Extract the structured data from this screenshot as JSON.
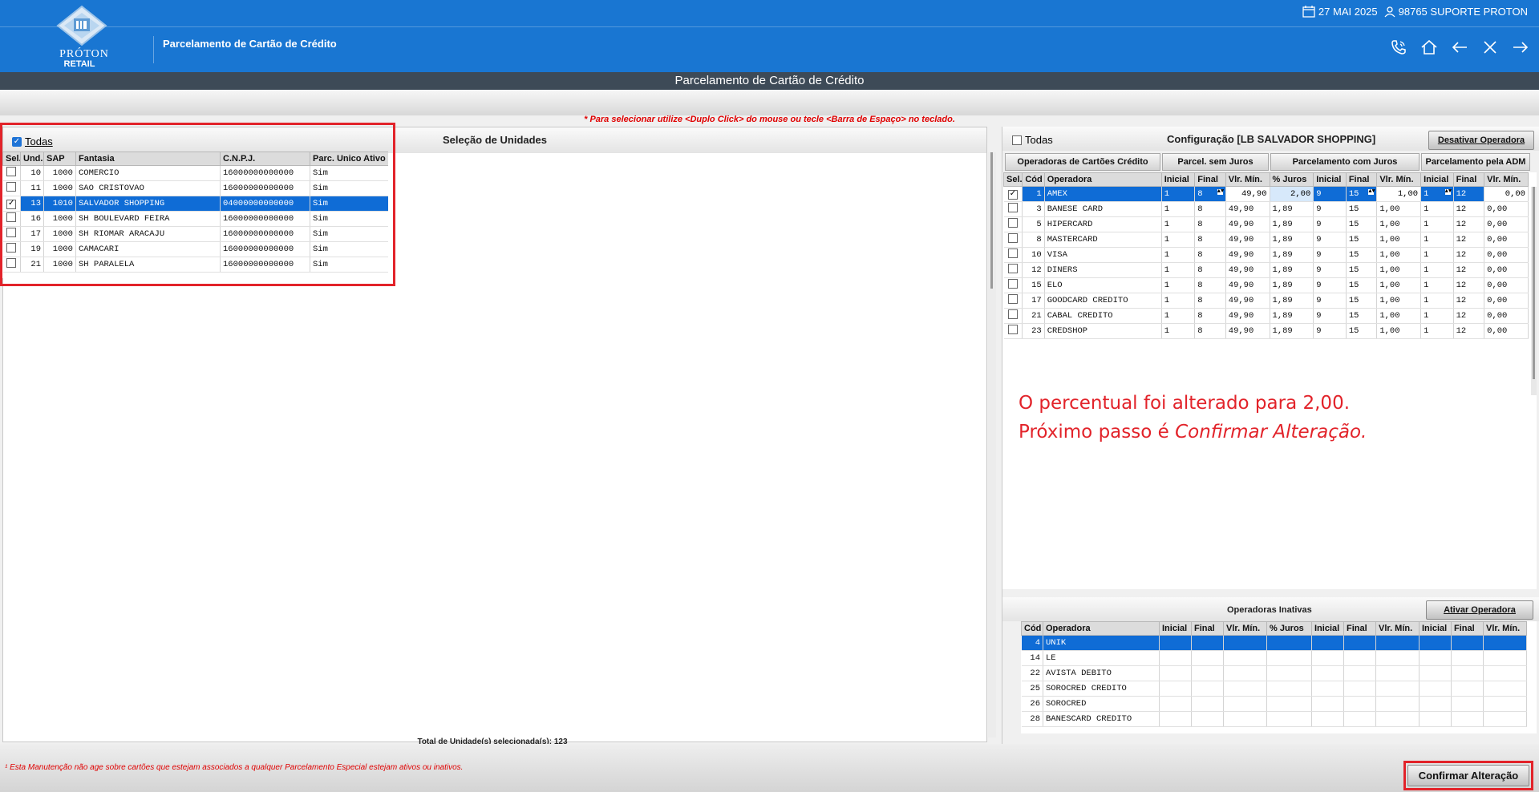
{
  "header": {
    "logo_name": "PRÓTON",
    "logo_sub": "RETAIL",
    "module_title": "Parcelamento de Cartão de Crédito",
    "date": "27 MAI 2025",
    "user": "98765 SUPORTE PROTON",
    "accent": "#1976d2"
  },
  "subbar": {
    "title": "Parcelamento de Cartão de Crédito"
  },
  "hint": "* Para selecionar utilize <Duplo Click> do mouse ou tecle <Barra de Espaço> no teclado.",
  "units": {
    "title": "Seleção de Unidades",
    "todas_label": "Todas",
    "columns": [
      "Sel.",
      "Und.",
      "SAP",
      "Fantasia",
      "C.N.P.J.",
      "Parc. Unico Ativo"
    ],
    "rows": [
      {
        "und": "10",
        "sap": "1000",
        "fantasia": "COMERCIO",
        "cnpj": "16000000000000",
        "parc": "Sim",
        "checked": false,
        "selected": false
      },
      {
        "und": "11",
        "sap": "1000",
        "fantasia": "SAO CRISTOVAO",
        "cnpj": "16000000000000",
        "parc": "Sim",
        "checked": false,
        "selected": false
      },
      {
        "und": "13",
        "sap": "1010",
        "fantasia": "SALVADOR SHOPPING",
        "cnpj": "04000000000000",
        "parc": "Sim",
        "checked": true,
        "selected": true
      },
      {
        "und": "16",
        "sap": "1000",
        "fantasia": "SH BOULEVARD FEIRA",
        "cnpj": "16000000000000",
        "parc": "Sim",
        "checked": false,
        "selected": false
      },
      {
        "und": "17",
        "sap": "1000",
        "fantasia": "SH RIOMAR ARACAJU",
        "cnpj": "16000000000000",
        "parc": "Sim",
        "checked": false,
        "selected": false
      },
      {
        "und": "19",
        "sap": "1000",
        "fantasia": "CAMACARI",
        "cnpj": "16000000000000",
        "parc": "Sim",
        "checked": false,
        "selected": false
      },
      {
        "und": "21",
        "sap": "1000",
        "fantasia": "SH PARALELA",
        "cnpj": "16000000000000",
        "parc": "Sim",
        "checked": false,
        "selected": false
      }
    ],
    "total": "Total de Unidade(s) selecionada(s): 123"
  },
  "config": {
    "todas_label": "Todas",
    "title": "Configuração [LB SALVADOR SHOPPING]",
    "deactivate_btn": "Desativar Operadora",
    "tabs": [
      "Operadoras de Cartões Crédito",
      "Parcel.  sem Juros",
      "Parcelamento  com Juros",
      "Parcelamento pela ADM"
    ],
    "columns": [
      "Sel.",
      "Cód",
      "Operadora",
      "Inicial",
      "Final",
      "Vlr. Mín.",
      "% Juros",
      "Inicial",
      "Final",
      "Vlr. Mín.",
      "Inicial",
      "Final",
      "Vlr. Mín."
    ],
    "rows": [
      {
        "cod": "1",
        "op": "AMEX",
        "i1": "1",
        "f1": "8",
        "v1": "49,90",
        "j": "2,00",
        "i2": "9",
        "f2": "15",
        "v2": "1,00",
        "i3": "1",
        "f3": "12",
        "v3": "0,00",
        "checked": true,
        "selected": true
      },
      {
        "cod": "3",
        "op": "BANESE CARD",
        "i1": "1",
        "f1": "8",
        "v1": "49,90",
        "j": "1,89",
        "i2": "9",
        "f2": "15",
        "v2": "1,00",
        "i3": "1",
        "f3": "12",
        "v3": "0,00",
        "checked": false,
        "selected": false
      },
      {
        "cod": "5",
        "op": "HIPERCARD",
        "i1": "1",
        "f1": "8",
        "v1": "49,90",
        "j": "1,89",
        "i2": "9",
        "f2": "15",
        "v2": "1,00",
        "i3": "1",
        "f3": "12",
        "v3": "0,00",
        "checked": false,
        "selected": false
      },
      {
        "cod": "8",
        "op": "MASTERCARD",
        "i1": "1",
        "f1": "8",
        "v1": "49,90",
        "j": "1,89",
        "i2": "9",
        "f2": "15",
        "v2": "1,00",
        "i3": "1",
        "f3": "12",
        "v3": "0,00",
        "checked": false,
        "selected": false
      },
      {
        "cod": "10",
        "op": "VISA",
        "i1": "1",
        "f1": "8",
        "v1": "49,90",
        "j": "1,89",
        "i2": "9",
        "f2": "15",
        "v2": "1,00",
        "i3": "1",
        "f3": "12",
        "v3": "0,00",
        "checked": false,
        "selected": false
      },
      {
        "cod": "12",
        "op": "DINERS",
        "i1": "1",
        "f1": "8",
        "v1": "49,90",
        "j": "1,89",
        "i2": "9",
        "f2": "15",
        "v2": "1,00",
        "i3": "1",
        "f3": "12",
        "v3": "0,00",
        "checked": false,
        "selected": false
      },
      {
        "cod": "15",
        "op": "ELO",
        "i1": "1",
        "f1": "8",
        "v1": "49,90",
        "j": "1,89",
        "i2": "9",
        "f2": "15",
        "v2": "1,00",
        "i3": "1",
        "f3": "12",
        "v3": "0,00",
        "checked": false,
        "selected": false
      },
      {
        "cod": "17",
        "op": "GOODCARD CREDITO",
        "i1": "1",
        "f1": "8",
        "v1": "49,90",
        "j": "1,89",
        "i2": "9",
        "f2": "15",
        "v2": "1,00",
        "i3": "1",
        "f3": "12",
        "v3": "0,00",
        "checked": false,
        "selected": false
      },
      {
        "cod": "21",
        "op": "CABAL CREDITO",
        "i1": "1",
        "f1": "8",
        "v1": "49,90",
        "j": "1,89",
        "i2": "9",
        "f2": "15",
        "v2": "1,00",
        "i3": "1",
        "f3": "12",
        "v3": "0,00",
        "checked": false,
        "selected": false
      },
      {
        "cod": "23",
        "op": "CREDSHOP",
        "i1": "1",
        "f1": "8",
        "v1": "49,90",
        "j": "1,89",
        "i2": "9",
        "f2": "15",
        "v2": "1,00",
        "i3": "1",
        "f3": "12",
        "v3": "0,00",
        "checked": false,
        "selected": false
      }
    ],
    "note_line1": "O percentual foi alterado para 2,00.",
    "note_line2_prefix": "Próximo passo é ",
    "note_line2_em": "Confirmar Alteração."
  },
  "inactive": {
    "title": "Operadoras Inativas",
    "activate_btn": "Ativar Operadora",
    "columns": [
      "Cód",
      "Operadora",
      "Inicial",
      "Final",
      "Vlr. Mín.",
      "% Juros",
      "Inicial",
      "Final",
      "Vlr. Mín.",
      "Inicial",
      "Final",
      "Vlr. Mín."
    ],
    "rows": [
      {
        "cod": "4",
        "op": "UNIK",
        "selected": true
      },
      {
        "cod": "14",
        "op": "LE",
        "selected": false
      },
      {
        "cod": "22",
        "op": "AVISTA DEBITO",
        "selected": false
      },
      {
        "cod": "25",
        "op": "SOROCRED CREDITO",
        "selected": false
      },
      {
        "cod": "26",
        "op": "SOROCRED",
        "selected": false
      },
      {
        "cod": "28",
        "op": "BANESCARD CREDITO",
        "selected": false
      }
    ]
  },
  "footnote": "¹ Esta Manutenção não age sobre cartões que estejam associados a qualquer Parcelamento Especial estejam ativos ou inativos.",
  "confirm_btn": "Confirmar Alteração",
  "colors": {
    "selection": "#0f6cd6",
    "annotation_red": "#e2232a"
  }
}
